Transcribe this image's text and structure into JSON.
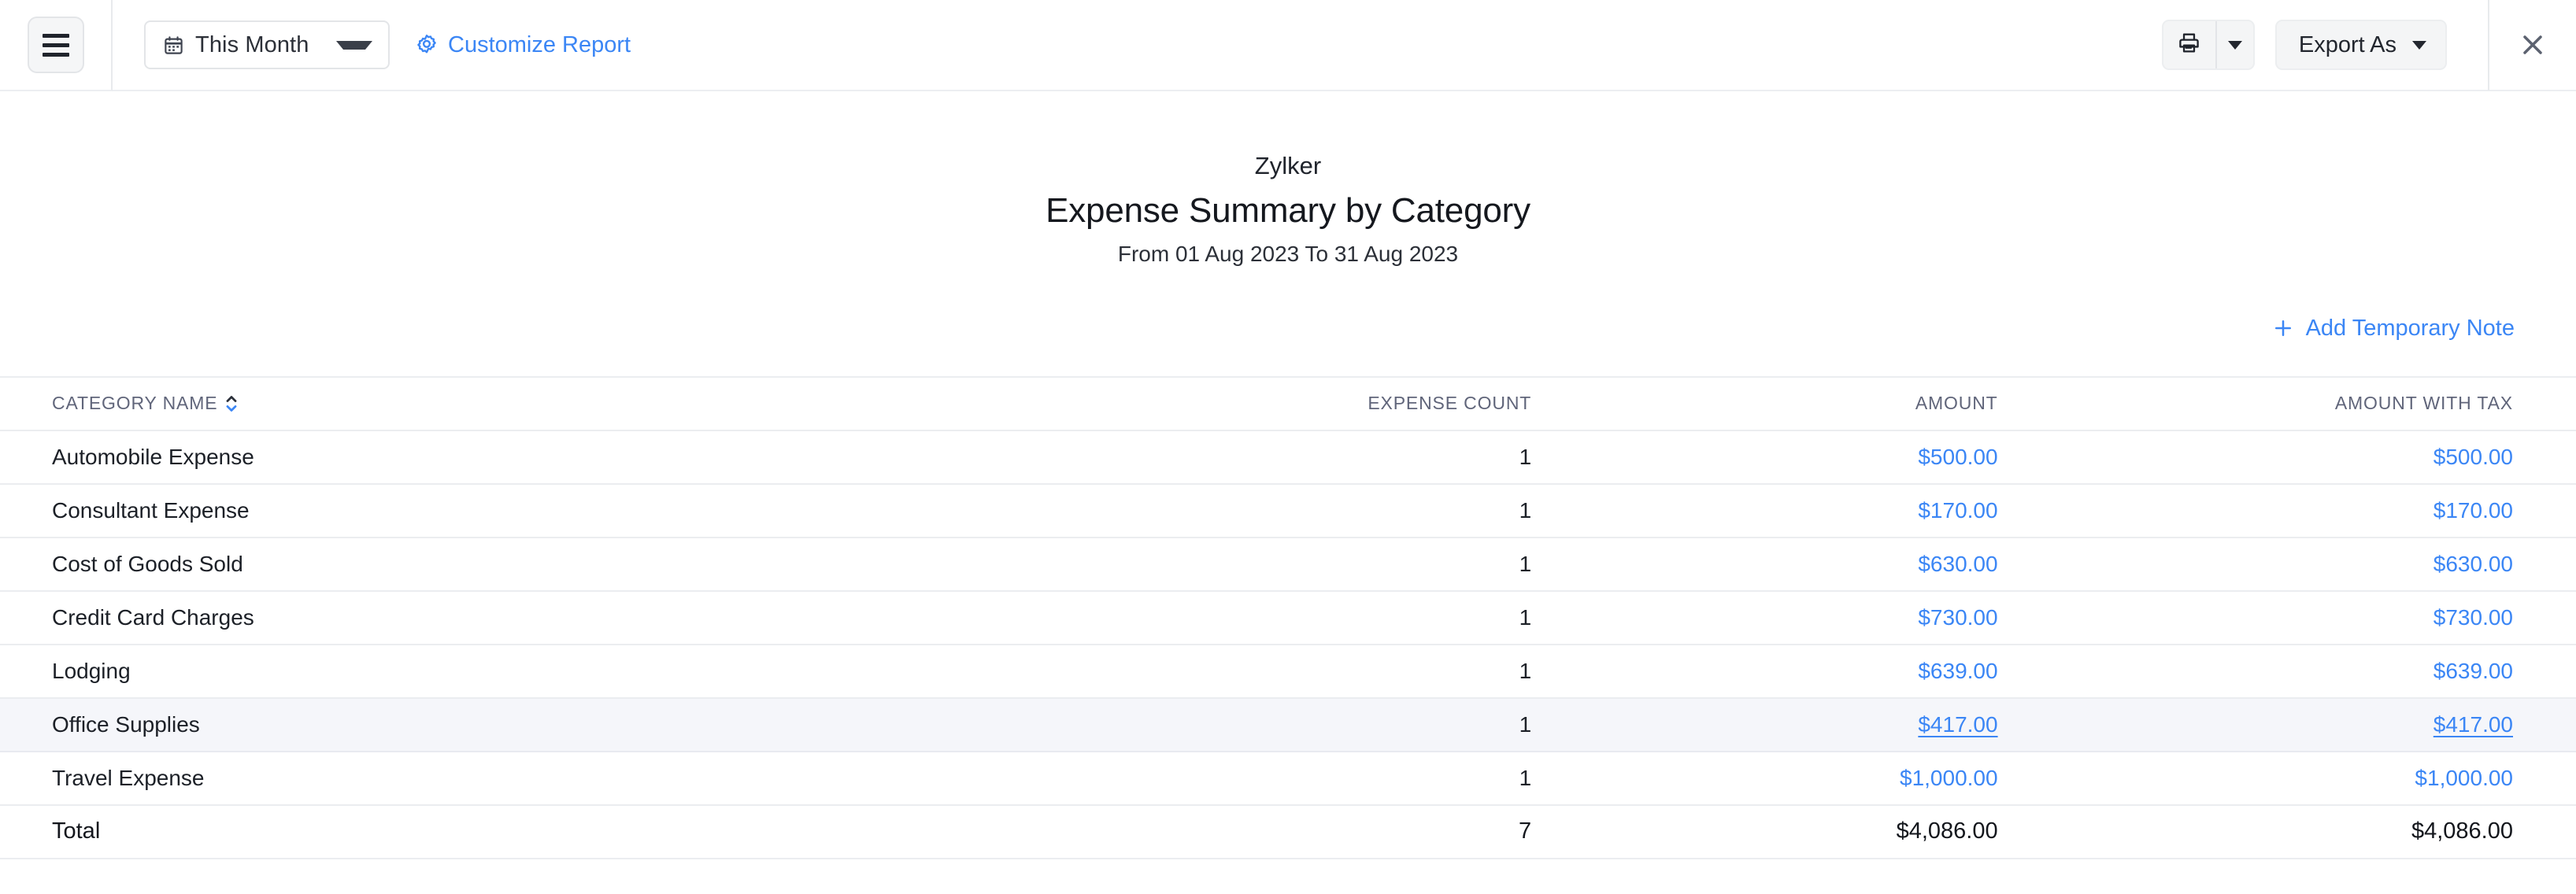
{
  "toolbar": {
    "menu_icon": "hamburger-menu-icon",
    "date_range": {
      "icon": "calendar-icon",
      "value": "This Month",
      "caret": "chevron-down-icon"
    },
    "customize_report": {
      "icon": "gear-icon",
      "label": "Customize Report"
    },
    "print": {
      "icon": "printer-icon",
      "caret": "chevron-down-icon"
    },
    "export": {
      "label": "Export As",
      "caret": "chevron-down-icon"
    },
    "close": {
      "icon": "close-icon"
    }
  },
  "report": {
    "organization": "Zylker",
    "title": "Expense Summary by Category",
    "period": "From 01 Aug 2023 To 31 Aug 2023",
    "add_note": {
      "icon": "plus-icon",
      "label": "Add Temporary Note"
    }
  },
  "table": {
    "columns": [
      {
        "key": "category",
        "label": "CATEGORY NAME",
        "sortable": true
      },
      {
        "key": "count",
        "label": "EXPENSE COUNT",
        "sortable": false
      },
      {
        "key": "amount",
        "label": "AMOUNT",
        "sortable": false
      },
      {
        "key": "amount_with_tax",
        "label": "AMOUNT WITH TAX",
        "sortable": false
      }
    ],
    "rows": [
      {
        "category": "Automobile Expense",
        "count": "1",
        "amount": "$500.00",
        "amount_with_tax": "$500.00",
        "hovered": false
      },
      {
        "category": "Consultant Expense",
        "count": "1",
        "amount": "$170.00",
        "amount_with_tax": "$170.00",
        "hovered": false
      },
      {
        "category": "Cost of Goods Sold",
        "count": "1",
        "amount": "$630.00",
        "amount_with_tax": "$630.00",
        "hovered": false
      },
      {
        "category": "Credit Card Charges",
        "count": "1",
        "amount": "$730.00",
        "amount_with_tax": "$730.00",
        "hovered": false
      },
      {
        "category": "Lodging",
        "count": "1",
        "amount": "$639.00",
        "amount_with_tax": "$639.00",
        "hovered": false
      },
      {
        "category": "Office Supplies",
        "count": "1",
        "amount": "$417.00",
        "amount_with_tax": "$417.00",
        "hovered": true
      },
      {
        "category": "Travel Expense",
        "count": "1",
        "amount": "$1,000.00",
        "amount_with_tax": "$1,000.00",
        "hovered": false
      }
    ],
    "total": {
      "label": "Total",
      "count": "7",
      "amount": "$4,086.00",
      "amount_with_tax": "$4,086.00"
    }
  },
  "colors": {
    "link": "#3b86f5",
    "text": "#1c2027",
    "header_text": "#60657a",
    "border": "#ebedf0",
    "hover_row": "#f5f6fa",
    "button_bg": "#f4f5f6"
  }
}
